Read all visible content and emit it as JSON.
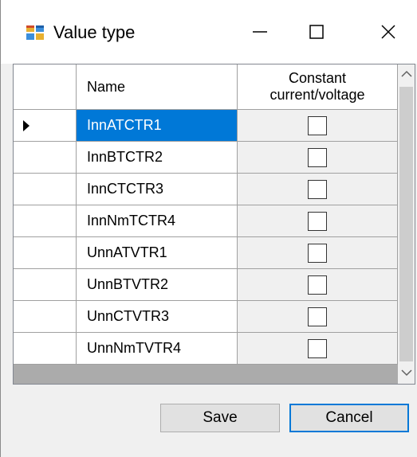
{
  "window": {
    "title": "Value type",
    "icon": "app-window-icon",
    "controls": [
      "minimize-icon",
      "maximize-icon",
      "close-icon"
    ]
  },
  "grid": {
    "columns": {
      "name": "Name",
      "constant_line1": "Constant",
      "constant_line2": "current/voltage"
    },
    "rows": [
      {
        "name": "InnATCTR1",
        "checked": false,
        "selected": true,
        "current": true
      },
      {
        "name": "InnBTCTR2",
        "checked": false
      },
      {
        "name": "InnCTCTR3",
        "checked": false
      },
      {
        "name": "InnNmTCTR4",
        "checked": false
      },
      {
        "name": "UnnATVTR1",
        "checked": false
      },
      {
        "name": "UnnBTVTR2",
        "checked": false
      },
      {
        "name": "UnnCTVTR3",
        "checked": false
      },
      {
        "name": "UnnNmTVTR4",
        "checked": false
      }
    ]
  },
  "buttons": {
    "save": "Save",
    "cancel": "Cancel"
  },
  "colors": {
    "selection": "#0078d7",
    "grid_bg": "#ababab"
  }
}
